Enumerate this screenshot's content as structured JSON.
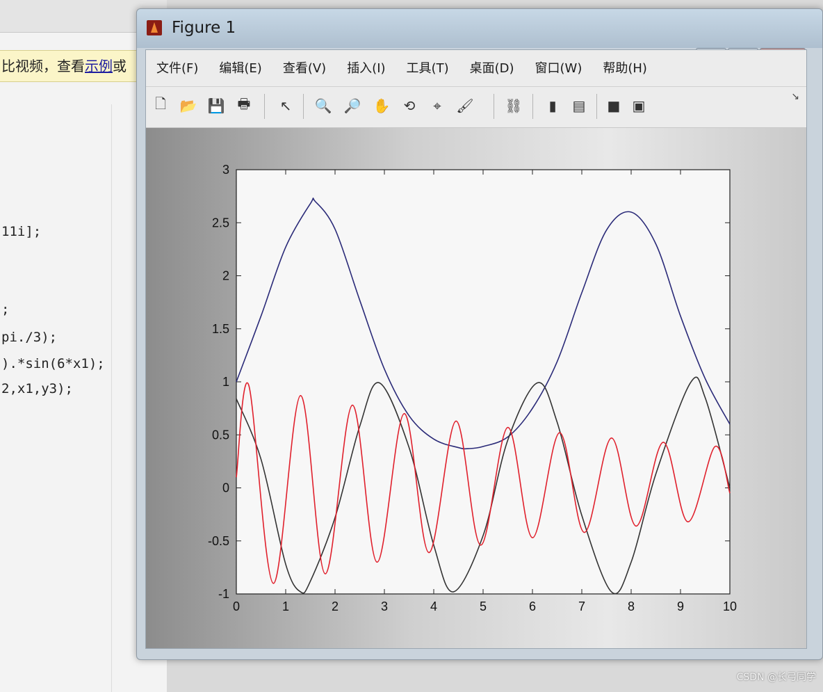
{
  "editor": {
    "banner": {
      "text_a": "比视频",
      "text_b": "，查看",
      "link": "示例",
      "text_c": "或"
    },
    "code_lines": [
      "11i];",
      ";",
      "pi./3);",
      ").*sin(6*x1);",
      "2,x1,y3);"
    ]
  },
  "window": {
    "title": "Figure 1",
    "buttons": {
      "minimize": "▁",
      "maximize": "▭",
      "close": "X"
    }
  },
  "menubar": {
    "items": [
      "文件(F)",
      "编辑(E)",
      "查看(V)",
      "插入(I)",
      "工具(T)",
      "桌面(D)",
      "窗口(W)",
      "帮助(H)"
    ]
  },
  "toolbar": {
    "icons": [
      "new-figure-icon",
      "open-icon",
      "save-icon",
      "print-icon",
      "pointer-icon",
      "zoom-in-icon",
      "zoom-out-icon",
      "pan-icon",
      "rotate-icon",
      "data-cursor-icon",
      "brush-icon",
      "link-icon",
      "colorbar-icon",
      "legend-icon",
      "hide-tools-icon",
      "show-tools-icon"
    ],
    "glyphs": [
      "🗋",
      "📂",
      "💾",
      "🖶",
      "↖",
      "🔍",
      "🔎",
      "✋",
      "⟲",
      "⌖",
      "🖌",
      "⛓",
      "▮",
      "▤",
      "■",
      "▣"
    ]
  },
  "chart_data": {
    "type": "line",
    "xlim": [
      0,
      10
    ],
    "ylim": [
      -1,
      3
    ],
    "xticks": [
      "0",
      "1",
      "2",
      "3",
      "4",
      "5",
      "6",
      "7",
      "8",
      "9",
      "10"
    ],
    "yticks": [
      "-1",
      "-0.5",
      "0",
      "0.5",
      "1",
      "1.5",
      "2",
      "2.5",
      "3"
    ],
    "grid": false,
    "series": [
      {
        "color": "#2a2a78",
        "x": [
          0,
          0.5,
          1,
          1.5,
          1.6,
          2,
          2.5,
          3,
          3.5,
          4,
          4.5,
          4.7,
          5,
          5.5,
          6,
          6.5,
          7,
          7.5,
          8,
          8.5,
          9,
          9.5,
          10
        ],
        "y": [
          1.0,
          1.62,
          2.27,
          2.68,
          2.7,
          2.44,
          1.77,
          1.12,
          0.68,
          0.46,
          0.38,
          0.37,
          0.39,
          0.48,
          0.75,
          1.19,
          1.84,
          2.43,
          2.6,
          2.3,
          1.62,
          1.03,
          0.6
        ]
      },
      {
        "color": "#333333",
        "x": [
          0,
          0.5,
          1,
          1.3,
          1.5,
          2,
          2.5,
          2.9,
          3.5,
          4,
          4.4,
          5,
          5.5,
          6.1,
          6.5,
          7,
          7.6,
          8,
          8.5,
          9.2,
          9.5,
          10
        ],
        "y": [
          0.84,
          0.27,
          -0.72,
          -0.98,
          -0.88,
          -0.28,
          0.58,
          0.99,
          0.38,
          -0.54,
          -0.98,
          -0.45,
          0.45,
          0.99,
          0.62,
          -0.26,
          -0.98,
          -0.7,
          0.13,
          0.99,
          0.85,
          0.0
        ]
      },
      {
        "color": "#e0202c",
        "x": [
          0,
          0.25,
          0.75,
          1.3,
          1.8,
          2.35,
          2.85,
          3.4,
          3.9,
          4.45,
          4.95,
          5.5,
          6.0,
          6.55,
          7.05,
          7.6,
          8.1,
          8.65,
          9.15,
          9.7,
          10
        ],
        "y": [
          0.1,
          0.97,
          -0.9,
          0.87,
          -0.81,
          0.78,
          -0.7,
          0.7,
          -0.61,
          0.63,
          -0.54,
          0.57,
          -0.47,
          0.52,
          -0.42,
          0.47,
          -0.36,
          0.43,
          -0.32,
          0.39,
          -0.05
        ]
      }
    ]
  },
  "watermark": "CSDN @长弓同学"
}
